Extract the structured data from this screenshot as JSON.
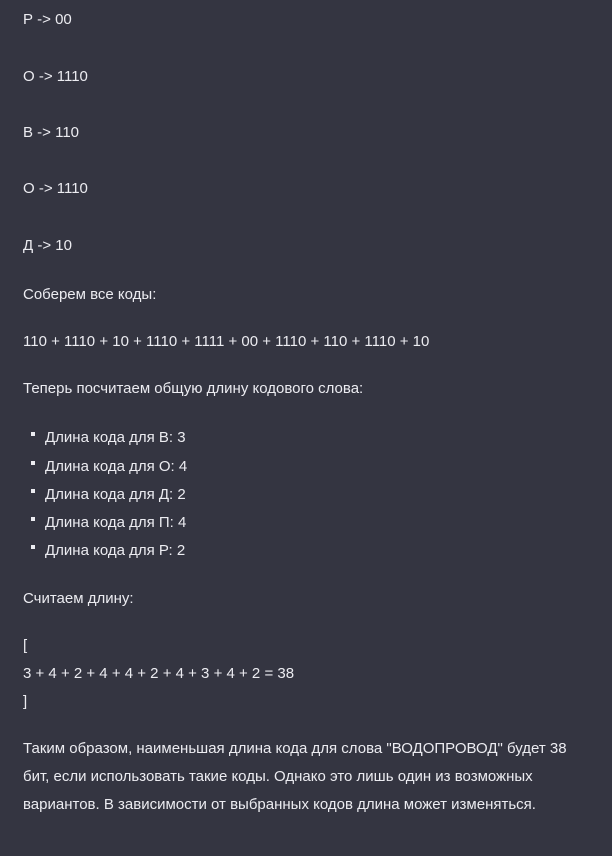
{
  "codes": [
    "Р -> 00",
    "О -> 1110",
    "В -> 110",
    "О -> 1110",
    "Д -> 10"
  ],
  "collect_heading": "Соберем все коды:",
  "collect_expr": "110 + 1110 + 10 + 1110 + 1111 + 00 + 1110 + 110 + 1110 + 10",
  "length_heading": "Теперь посчитаем общую длину кодового слова:",
  "lengths": [
    "Длина кода для В: 3",
    "Длина кода для О: 4",
    "Длина кода для Д: 2",
    "Длина кода для П: 4",
    "Длина кода для Р: 2"
  ],
  "count_heading": "Считаем длину:",
  "formula_open": "[",
  "formula": "3 + 4 + 2 + 4 + 4 + 2 + 4 + 3 + 4 + 2 = 38",
  "formula_close": "]",
  "conclusion": "Таким образом, наименьшая длина кода для слова \"ВОДОПРОВОД\" будет 38 бит, если использовать такие коды. Однако это лишь один из возможных вариантов. В зависимости от выбранных кодов длина может изменяться."
}
